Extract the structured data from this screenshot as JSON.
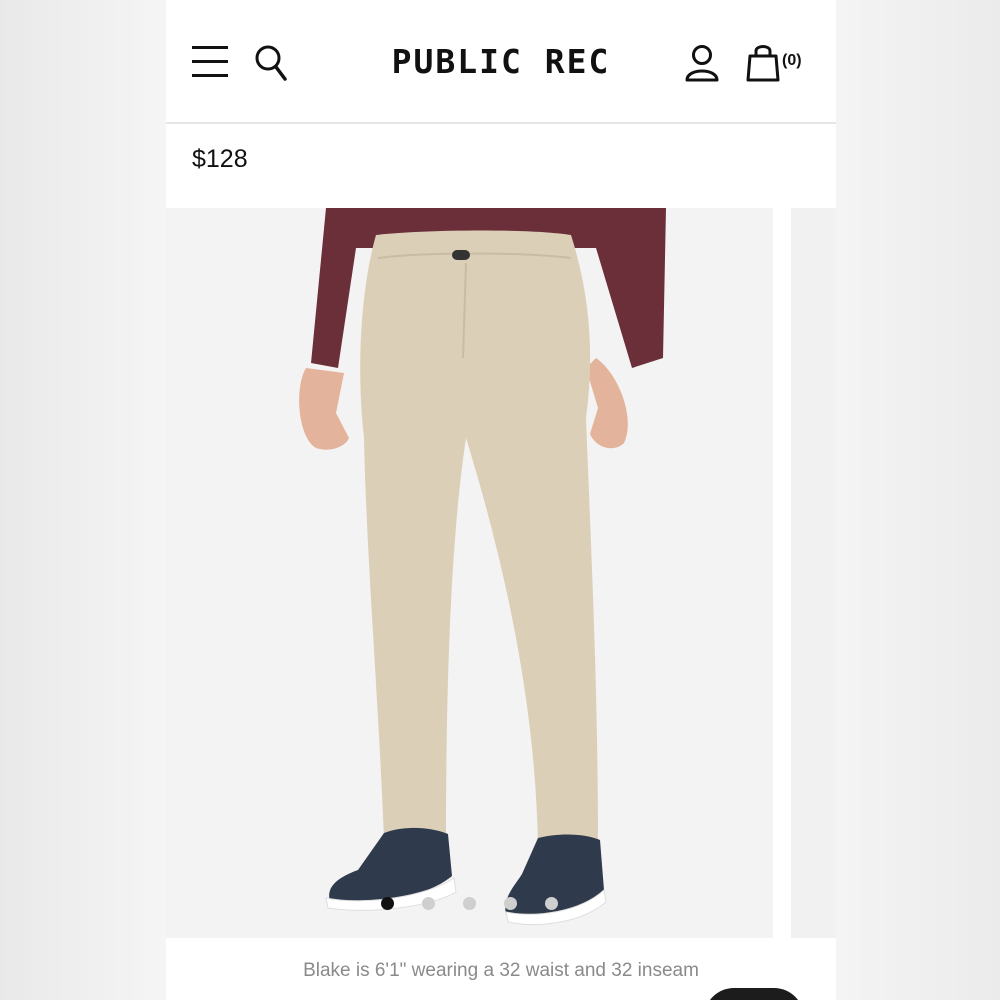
{
  "header": {
    "brand": "PUBLIC REC",
    "cart_count": "(0)",
    "icons": [
      "menu-icon",
      "search-icon",
      "account-icon",
      "bag-icon"
    ]
  },
  "product": {
    "price": "$128",
    "image_count": 5,
    "active_image": 1
  },
  "caption": "Blake is 6'1\" wearing a 32 waist and 32 inseam",
  "colors": {
    "text": "#111111",
    "caption": "#8a8a8a",
    "pants": "#dccfb8",
    "shirt": "#6b2f3a",
    "shoes": "#2f3a4d"
  }
}
